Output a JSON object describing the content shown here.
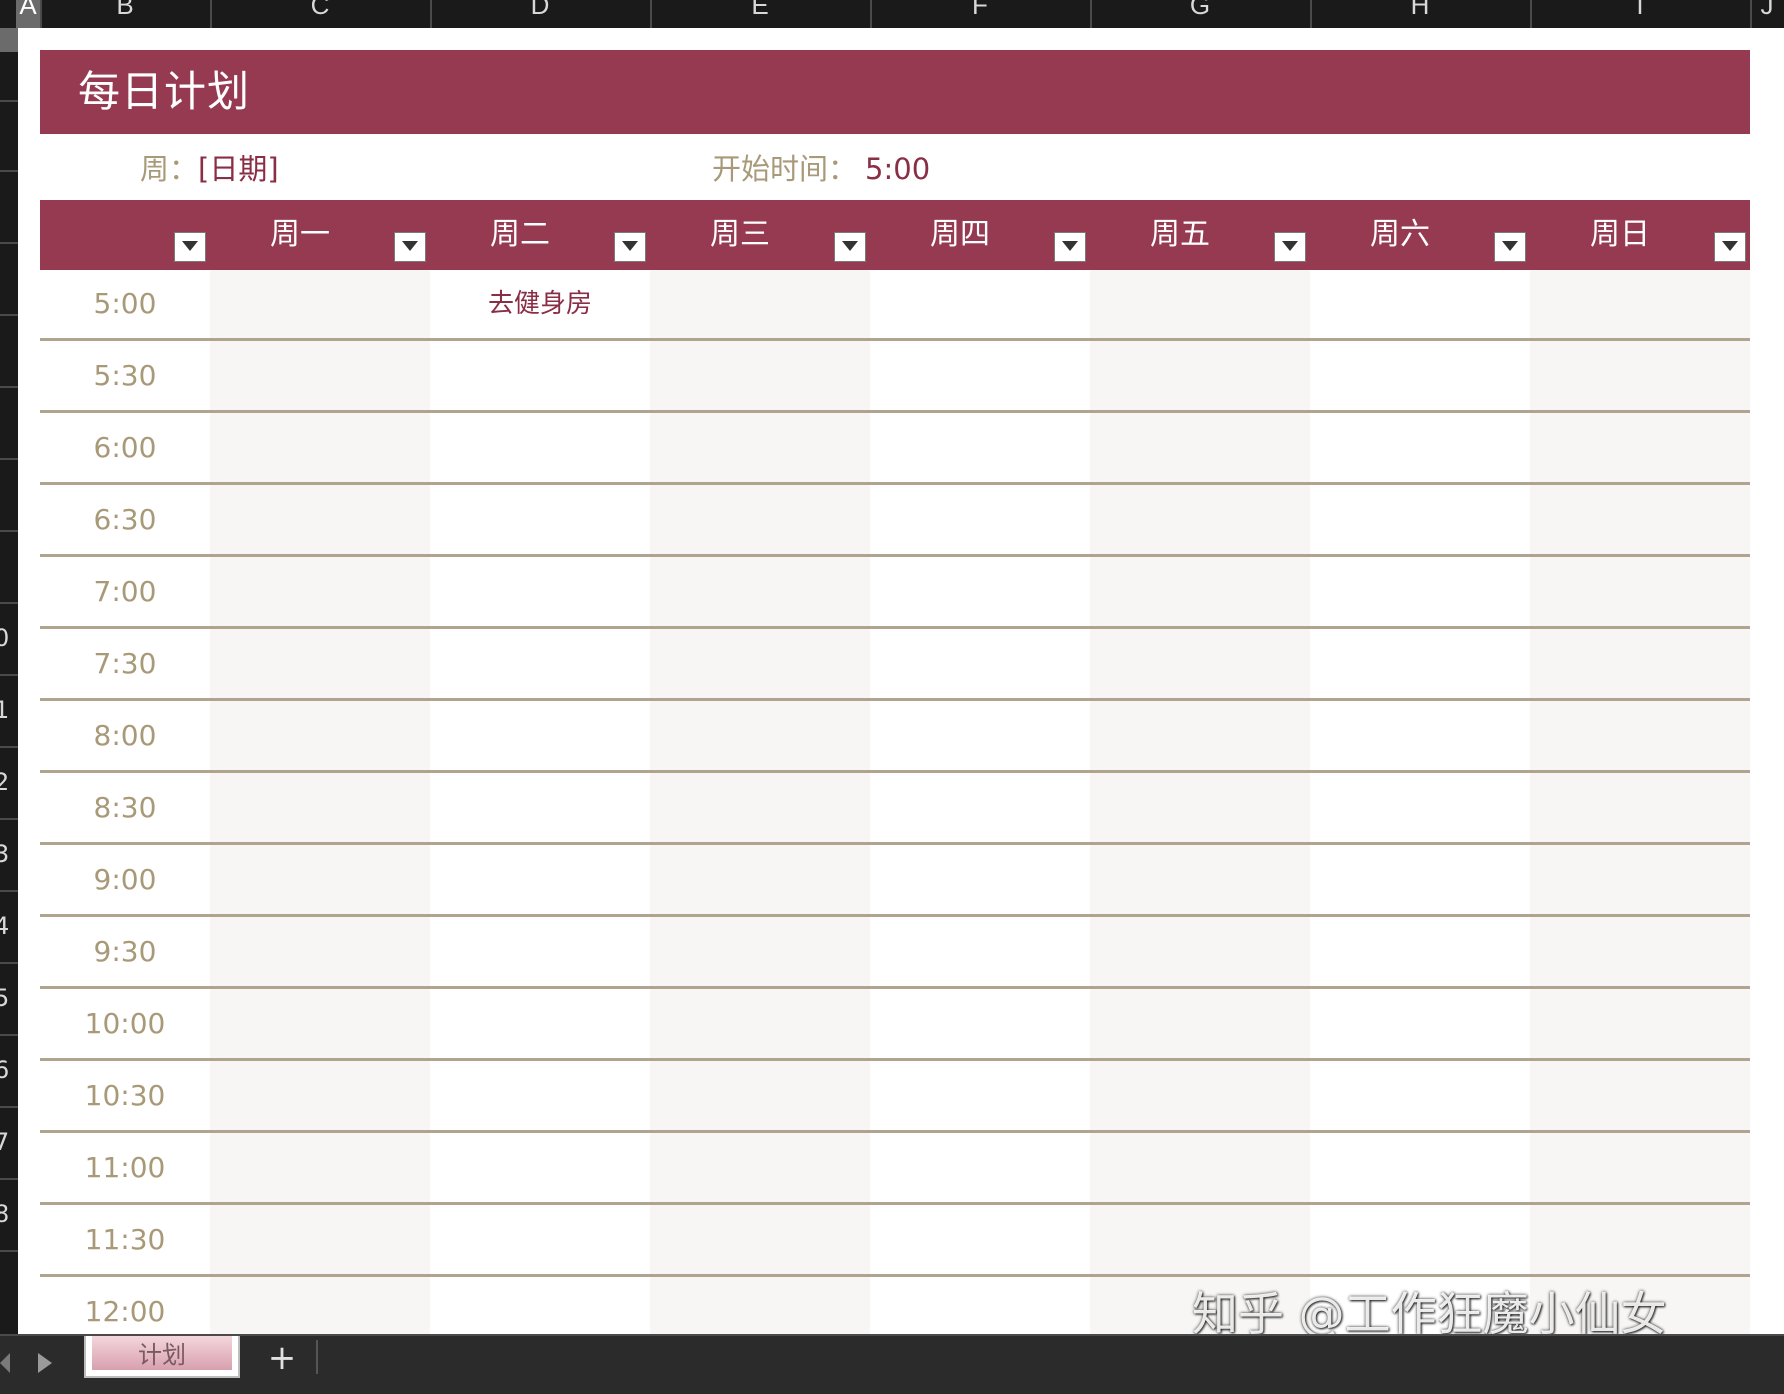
{
  "spreadsheet": {
    "column_headers": [
      "A",
      "B",
      "C",
      "D",
      "E",
      "F",
      "G",
      "H",
      "I",
      "J"
    ],
    "selected_column": "A",
    "row_numbers": [
      "",
      "",
      "",
      "",
      "",
      "",
      "",
      "",
      "0",
      "1",
      "2",
      "3",
      "4",
      "5",
      "6",
      "7",
      "8"
    ]
  },
  "sheet": {
    "title": "每日计划",
    "week_label": "周：",
    "week_value": "[日期]",
    "start_time_label": "开始时间：",
    "start_time_value": "5:00"
  },
  "planner": {
    "days": [
      "周一",
      "周二",
      "周三",
      "周四",
      "周五",
      "周六",
      "周日"
    ],
    "times": [
      "5:00",
      "5:30",
      "6:00",
      "6:30",
      "7:00",
      "7:30",
      "8:00",
      "8:30",
      "9:00",
      "9:30",
      "10:00",
      "10:30",
      "11:00",
      "11:30",
      "12:00"
    ],
    "entries": [
      {
        "time": "5:00",
        "day": "周二",
        "text": "去健身房"
      }
    ]
  },
  "tabs": {
    "sheets": [
      "计划"
    ],
    "active": "计划",
    "add_label": "+"
  },
  "watermark": "知乎 @工作狂魔小仙女",
  "colors": {
    "header_bg": "#963a52",
    "label_text": "#a89a78",
    "value_text": "#8a2e46",
    "row_rule": "#b0a48e",
    "shaded_column": "#f7f6f4"
  },
  "icons": {
    "dropdown": "chevron-down-icon",
    "scroll_left": "triangle-left-icon",
    "scroll_right": "triangle-right-icon"
  }
}
